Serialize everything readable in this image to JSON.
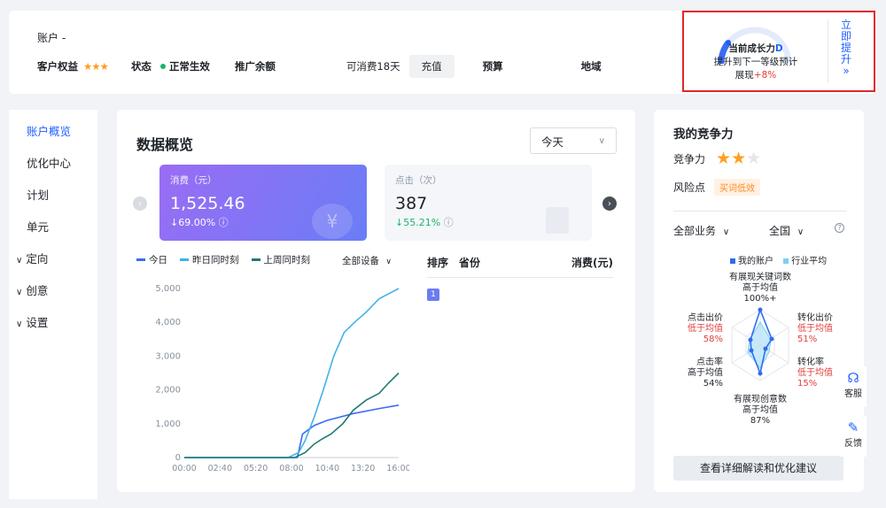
{
  "header": {
    "account_label": "账户 -",
    "rights_label": "客户权益",
    "rights_stars": "★★★",
    "status_label": "状态",
    "status_value": "正常生效",
    "balance_label": "推广余额",
    "consume_days": "可消费18天",
    "recharge_label": "充值",
    "budget_label": "预算",
    "region_label": "地域"
  },
  "growth": {
    "title_prefix": "当前成长力",
    "level": "D",
    "line2": "提升到下一等级预计",
    "line3_prefix": "展现",
    "line3_value": "+8%",
    "upgrade_label": "立即提升",
    "upgrade_arrow": "»"
  },
  "sidenav": {
    "items": [
      {
        "label": "账户概览",
        "active": true
      },
      {
        "label": "优化中心"
      },
      {
        "label": "计划"
      },
      {
        "label": "单元"
      },
      {
        "label": "定向",
        "expandable": true
      },
      {
        "label": "创意",
        "expandable": true
      },
      {
        "label": "设置",
        "expandable": true
      }
    ],
    "expand_icon": "∨"
  },
  "overview": {
    "title": "数据概览",
    "period": "今天",
    "period_caret": "∨",
    "metrics": [
      {
        "label": "消费（元）",
        "value": "1,525.46",
        "change": "↓69.00%",
        "info": "ⓘ"
      },
      {
        "label": "点击（次）",
        "value": "387",
        "change": "↓55.21%",
        "info": "ⓘ"
      }
    ],
    "legend": [
      {
        "label": "今日",
        "color": "#3b6cf4"
      },
      {
        "label": "昨日同时刻",
        "color": "#3fb3ea"
      },
      {
        "label": "上周同时刻",
        "color": "#1f7a72"
      }
    ],
    "device_label": "全部设备",
    "device_caret": "∨",
    "ranking": {
      "headers": [
        "排序",
        "省份",
        "消费(元)"
      ],
      "rows": [
        {
          "rank": "1"
        }
      ]
    }
  },
  "chart_data": {
    "type": "line",
    "x_ticks": [
      "00:00",
      "02:40",
      "05:20",
      "08:00",
      "10:40",
      "13:20",
      "16:00"
    ],
    "y_ticks": [
      "0",
      "1,000",
      "2,000",
      "3,000",
      "4,000",
      "5,000"
    ],
    "ylim": [
      0,
      5000
    ],
    "x_hours": [
      0,
      16.5
    ],
    "series": [
      {
        "name": "今日",
        "color": "#3b6cf4",
        "points": [
          [
            0,
            0
          ],
          [
            8,
            0
          ],
          [
            8.7,
            0
          ],
          [
            9.1,
            700
          ],
          [
            10,
            950
          ],
          [
            11,
            1100
          ],
          [
            13,
            1300
          ],
          [
            15,
            1450
          ],
          [
            16.5,
            1550
          ]
        ]
      },
      {
        "name": "昨日同时刻",
        "color": "#3fb3ea",
        "points": [
          [
            0,
            0
          ],
          [
            8,
            0
          ],
          [
            8.8,
            150
          ],
          [
            9.3,
            500
          ],
          [
            10,
            1200
          ],
          [
            10.7,
            2000
          ],
          [
            11.5,
            3000
          ],
          [
            12.3,
            3700
          ],
          [
            13.1,
            4000
          ],
          [
            14,
            4300
          ],
          [
            15,
            4700
          ],
          [
            16,
            4900
          ],
          [
            16.5,
            5000
          ]
        ]
      },
      {
        "name": "上周同时刻",
        "color": "#1f7a72",
        "points": [
          [
            0,
            0
          ],
          [
            8.5,
            0
          ],
          [
            9.3,
            150
          ],
          [
            10,
            400
          ],
          [
            10.6,
            550
          ],
          [
            11.3,
            700
          ],
          [
            12.2,
            1000
          ],
          [
            13,
            1400
          ],
          [
            14,
            1700
          ],
          [
            15,
            1900
          ],
          [
            15.7,
            2200
          ],
          [
            16.5,
            2500
          ]
        ]
      }
    ]
  },
  "competition": {
    "title": "我的竞争力",
    "power_label": "竞争力",
    "stars_filled": 2,
    "stars_total": 3,
    "risk_label": "风险点",
    "risk_value": "买词低效",
    "business_filter": "全部业务",
    "region_filter": "全国",
    "caret": "∨",
    "help_icon": "?",
    "legend_mine": "我的账户",
    "legend_avg": "行业平均",
    "radar": [
      {
        "name": "有展现关键词数",
        "status": "高于均值",
        "value": "100%+",
        "low": false
      },
      {
        "name": "转化出价",
        "status": "低于均值",
        "value": "51%",
        "low": true
      },
      {
        "name": "转化率",
        "status": "低于均值",
        "value": "15%",
        "low": true
      },
      {
        "name": "有展现创意数",
        "status": "高于均值",
        "value": "87%",
        "low": false
      },
      {
        "name": "点击率",
        "status": "高于均值",
        "value": "54%",
        "low": false
      },
      {
        "name": "点击出价",
        "status": "低于均值",
        "value": "58%",
        "low": true
      }
    ],
    "detail_button": "查看详细解读和优化建议"
  },
  "float_tools": {
    "service": "客服",
    "feedback": "反馈"
  }
}
